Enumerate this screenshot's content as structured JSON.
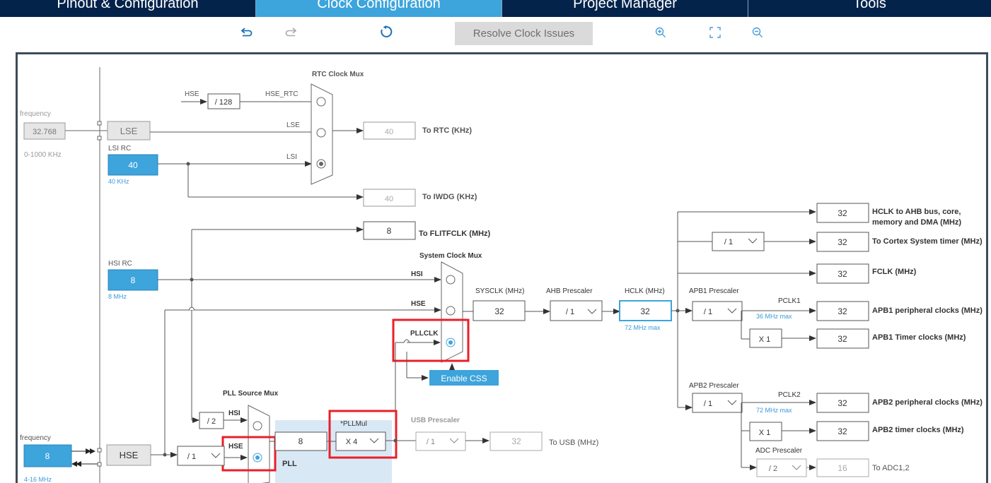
{
  "tabs": [
    {
      "label": "Pinout & Configuration",
      "active": false
    },
    {
      "label": "Clock Configuration",
      "active": true
    },
    {
      "label": "Project Manager",
      "active": false
    },
    {
      "label": "Tools",
      "active": false
    }
  ],
  "toolbar": {
    "resolve_label": "Resolve Clock Issues",
    "undo_icon": "undo-icon",
    "redo_icon": "redo-icon",
    "reset_icon": "reset-icon",
    "zoom_in_icon": "zoom-in-icon",
    "fit_icon": "fit-screen-icon",
    "zoom_out_icon": "zoom-out-icon"
  },
  "colors": {
    "tab_bar": "#03234b",
    "tab_active": "#3da4dc",
    "accent": "#3da4dc",
    "hint_text": "#3a9ad9",
    "highlight": "#e8202a",
    "pll_area": "#d9e8f5"
  },
  "lse": {
    "input_label": "Input frequency",
    "value": "32.768",
    "range": "0-1000 KHz",
    "label": "LSE"
  },
  "lsi": {
    "label": "LSI RC",
    "value": "40",
    "unit": "40 KHz"
  },
  "hsi": {
    "label": "HSI RC",
    "value": "8",
    "unit": "8 MHz"
  },
  "hse": {
    "input_label": "Input frequency",
    "value": "8",
    "range": "4-16 MHz",
    "label": "HSE"
  },
  "rtc": {
    "mux_label": "RTC Clock Mux",
    "hse_label": "HSE",
    "hse_rtc_label": "HSE_RTC",
    "div_label": "/ 128",
    "lse_label": "LSE",
    "lsi_label": "LSI",
    "rtc_value": "40",
    "rtc_label": "To RTC (KHz)",
    "iwdg_value": "40",
    "iwdg_label": "To IWDG (KHz)"
  },
  "flitf": {
    "value": "8",
    "label": "To FLITFCLK (MHz)"
  },
  "sysclk": {
    "mux_label": "System Clock Mux",
    "hsi_label": "HSI",
    "hse_label": "HSE",
    "pllclk_label": "PLLCLK",
    "label": "SYSCLK (MHz)",
    "value": "32",
    "css_label": "Enable CSS"
  },
  "ahb": {
    "label": "AHB Prescaler",
    "value": "/ 1"
  },
  "hclk": {
    "label": "HCLK (MHz)",
    "value": "32",
    "max": "72 MHz max"
  },
  "apb1": {
    "label": "APB1 Prescaler",
    "value": "/ 1",
    "pclk_label": "PCLK1",
    "max": "36 MHz max",
    "timer_mult": "X 1"
  },
  "apb2": {
    "label": "APB2 Prescaler",
    "value": "/ 1",
    "pclk_label": "PCLK2",
    "max": "72 MHz max",
    "timer_mult": "X 1"
  },
  "adc": {
    "label": "ADC Prescaler",
    "value": "/ 2",
    "out_value": "16",
    "out_label": "To ADC1,2"
  },
  "outputs": {
    "ahb_value": "32",
    "ahb_label": "HCLK to AHB bus, core,",
    "ahb_label2": "memory and DMA (MHz)",
    "cortex_div": "/ 1",
    "cortex_value": "32",
    "cortex_label": "To Cortex System timer (MHz)",
    "fclk_value": "32",
    "fclk_label": "FCLK (MHz)",
    "apb1p_value": "32",
    "apb1p_label": "APB1 peripheral clocks (MHz)",
    "apb1t_value": "32",
    "apb1t_label": "APB1 Timer clocks (MHz)",
    "apb2p_value": "32",
    "apb2p_label": "APB2 peripheral clocks (MHz)",
    "apb2t_value": "32",
    "apb2t_label": "APB2 timer clocks (MHz)"
  },
  "pll": {
    "src_mux_label": "PLL Source Mux",
    "div2_label": "/ 2",
    "hsi_label": "HSI",
    "hse_label": "HSE",
    "hse_prediv": "/ 1",
    "value": "8",
    "label": "PLL",
    "mul_label": "*PLLMul",
    "mul_value": "X 4"
  },
  "usb": {
    "label": "USB Prescaler",
    "value": "/ 1",
    "out_value": "32",
    "out_label": "To USB (MHz)"
  }
}
